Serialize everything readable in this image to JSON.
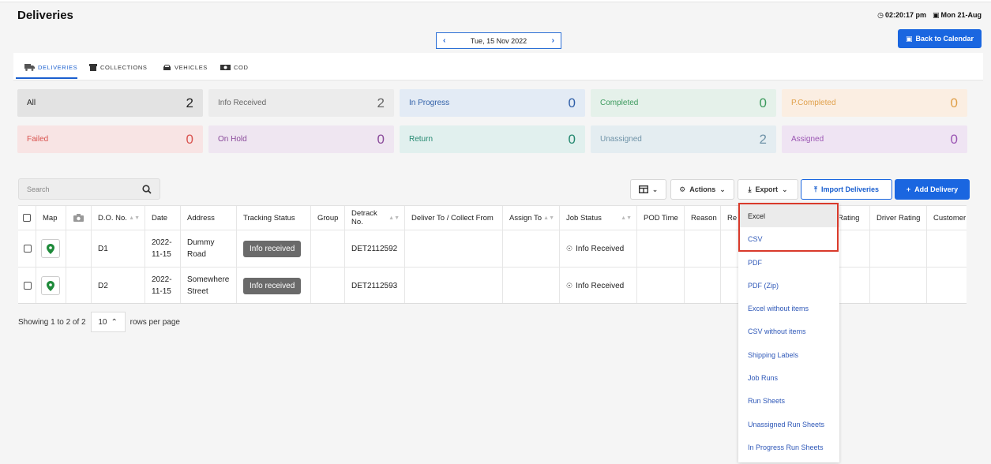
{
  "page": {
    "title": "Deliveries",
    "time": "02:20:17 pm",
    "date": "Mon 21-Aug"
  },
  "datebar": {
    "date": "Tue, 15 Nov 2022"
  },
  "back_label": "Back to Calendar",
  "tabs": [
    {
      "label": "DELIVERIES",
      "icon": "truck-icon"
    },
    {
      "label": "COLLECTIONS",
      "icon": "box-icon"
    },
    {
      "label": "VEHICLES",
      "icon": "car-icon"
    },
    {
      "label": "COD",
      "icon": "cash-icon"
    }
  ],
  "status_cards": [
    {
      "label": "All",
      "count": "2",
      "bg": "#e3e3e3",
      "fg": "#222222"
    },
    {
      "label": "Info Received",
      "count": "2",
      "bg": "#ececec",
      "fg": "#666666"
    },
    {
      "label": "In Progress",
      "count": "0",
      "bg": "#e3ebf5",
      "fg": "#2f5fa8"
    },
    {
      "label": "Completed",
      "count": "0",
      "bg": "#e5f1ea",
      "fg": "#3c9a5d"
    },
    {
      "label": "P.Completed",
      "count": "0",
      "bg": "#fbeee2",
      "fg": "#e0a04a"
    },
    {
      "label": "Failed",
      "count": "0",
      "bg": "#f8e4e4",
      "fg": "#d9534f"
    },
    {
      "label": "On Hold",
      "count": "0",
      "bg": "#efe6f1",
      "fg": "#8a4a9a"
    },
    {
      "label": "Return",
      "count": "0",
      "bg": "#e1f0ee",
      "fg": "#23886f"
    },
    {
      "label": "Unassigned",
      "count": "2",
      "bg": "#e4edf1",
      "fg": "#6f93a8"
    },
    {
      "label": "Assigned",
      "count": "0",
      "bg": "#efe4f3",
      "fg": "#9b55b3"
    }
  ],
  "search": {
    "placeholder": "Search"
  },
  "toolbar": {
    "actions": "Actions",
    "export": "Export",
    "import": "Import Deliveries",
    "add": "Add Delivery"
  },
  "columns": [
    "Map",
    "D.O. No.",
    "Date",
    "Address",
    "Tracking Status",
    "Group",
    "Detrack No.",
    "Deliver To / Collect From",
    "Assign To",
    "Job Status",
    "POD Time",
    "Reason",
    "Re",
    "Rating",
    "Driver Rating",
    "Customer"
  ],
  "rows": [
    {
      "do": "D1",
      "date1": "2022-",
      "date2": "11-15",
      "addr1": "Dummy",
      "addr2": "Road",
      "tracking": "Info received",
      "detrack": "DET2112592",
      "job_status": "Info Received"
    },
    {
      "do": "D2",
      "date1": "2022-",
      "date2": "11-15",
      "addr1": "Somewhere",
      "addr2": "Street",
      "tracking": "Info received",
      "detrack": "DET2112593",
      "job_status": "Info Received"
    }
  ],
  "pager": {
    "showing": "Showing 1 to 2 of 2",
    "per_page": "10",
    "rows_label": "rows per page"
  },
  "export_menu": [
    "Excel",
    "CSV",
    "PDF",
    "PDF (Zip)",
    "Excel without items",
    "CSV without items",
    "Shipping Labels",
    "Job Runs",
    "Run Sheets",
    "Unassigned Run Sheets",
    "In Progress Run Sheets"
  ]
}
